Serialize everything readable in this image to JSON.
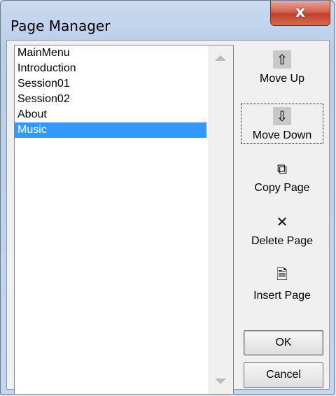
{
  "window": {
    "title": "Page Manager",
    "close_label": "x"
  },
  "pages": [
    {
      "label": "MainMenu",
      "selected": false
    },
    {
      "label": "Introduction",
      "selected": false
    },
    {
      "label": "Session01",
      "selected": false
    },
    {
      "label": "Session02",
      "selected": false
    },
    {
      "label": "About",
      "selected": false
    },
    {
      "label": "Music",
      "selected": true
    }
  ],
  "actions": {
    "move_up": {
      "label": "Move Up",
      "icon": "arrow-up-icon",
      "glyph": "⇧"
    },
    "move_down": {
      "label": "Move Down",
      "icon": "arrow-down-icon",
      "glyph": "⇩"
    },
    "copy_page": {
      "label": "Copy Page",
      "icon": "copy-icon",
      "glyph": "⧉"
    },
    "delete_page": {
      "label": "Delete Page",
      "icon": "delete-icon",
      "glyph": "✕"
    },
    "insert_page": {
      "label": "Insert Page",
      "icon": "insert-page-icon",
      "glyph": "🗎"
    }
  },
  "buttons": {
    "ok_label": "OK",
    "cancel_label": "Cancel"
  },
  "colors": {
    "selection": "#3399ff",
    "close_button": "#c8442e"
  }
}
